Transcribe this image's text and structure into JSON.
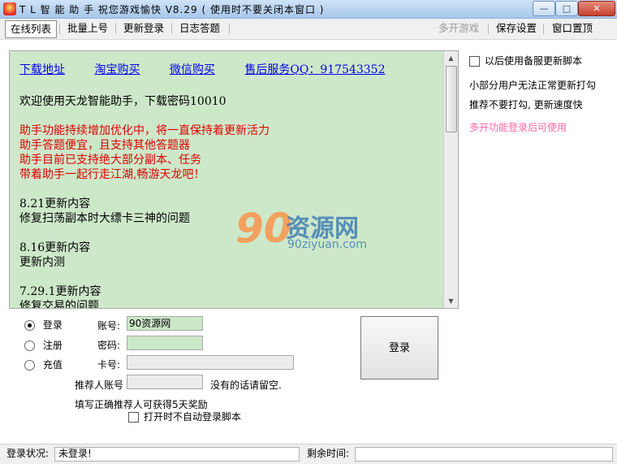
{
  "window": {
    "title": "T L 智 能 助 手 祝您游戏愉快 V8.29 ( 使用时不要关闭本窗口 )",
    "minimize": "—",
    "maximize": "□",
    "close": "✕"
  },
  "toolbar": {
    "tabs": [
      "在线列表",
      "批量上号",
      "更新登录",
      "日志答题"
    ],
    "right_buttons": [
      "多开游戏",
      "保存设置",
      "窗口置顶"
    ]
  },
  "info": {
    "links": [
      "下载地址",
      "淘宝购买",
      "微信购买",
      "售后服务QQ：917543352"
    ],
    "welcome": "欢迎使用天龙智能助手，下载密码10010",
    "red_lines": [
      " 助手功能持续增加优化中，将一直保持着更新活力",
      "助手答题便宜，且支持其他答题器",
      "助手目前已支持绝大部分副本、任务",
      "带着助手一起行走江湖,畅游天龙吧！"
    ],
    "updates": [
      {
        "version": "8.21更新内容",
        "detail": "修复扫荡副本时大缥卡三神的问题"
      },
      {
        "version": "8.16更新内容",
        "detail": "更新内测"
      },
      {
        "version": "7.29.1更新内容",
        "detail": "修复交易的问题"
      }
    ]
  },
  "watermark": {
    "num": "90",
    "name": "资源网",
    "url": "90ziyuan.com"
  },
  "right_panel": {
    "checkbox_label": "以后使用备服更新脚本",
    "note1": "小部分用户无法正常更新打勾",
    "note2": "推荐不要打勾, 更新速度快",
    "note3": "多开功能登录后可使用"
  },
  "login": {
    "radio_login": "登录",
    "radio_register": "注册",
    "radio_recharge": "充值",
    "account_label": "账号:",
    "account_value": "90资源网",
    "password_label": "密码:",
    "card_label": "卡号:",
    "referrer_label": "推荐人账号",
    "referrer_hint": "没有的话请留空.",
    "reward_text": "填写正确推荐人可获得5天奖励",
    "autologin_label": "打开时不自动登录脚本",
    "button": "登录"
  },
  "status": {
    "login_label": "登录状况:",
    "login_value": "未登录!",
    "remaining_label": "剩余时间:"
  },
  "colors": {
    "panel_bg": "#cde8c9",
    "link": "#0000ee",
    "red_text": "#e00000",
    "pink_text": "#ff66a8"
  }
}
